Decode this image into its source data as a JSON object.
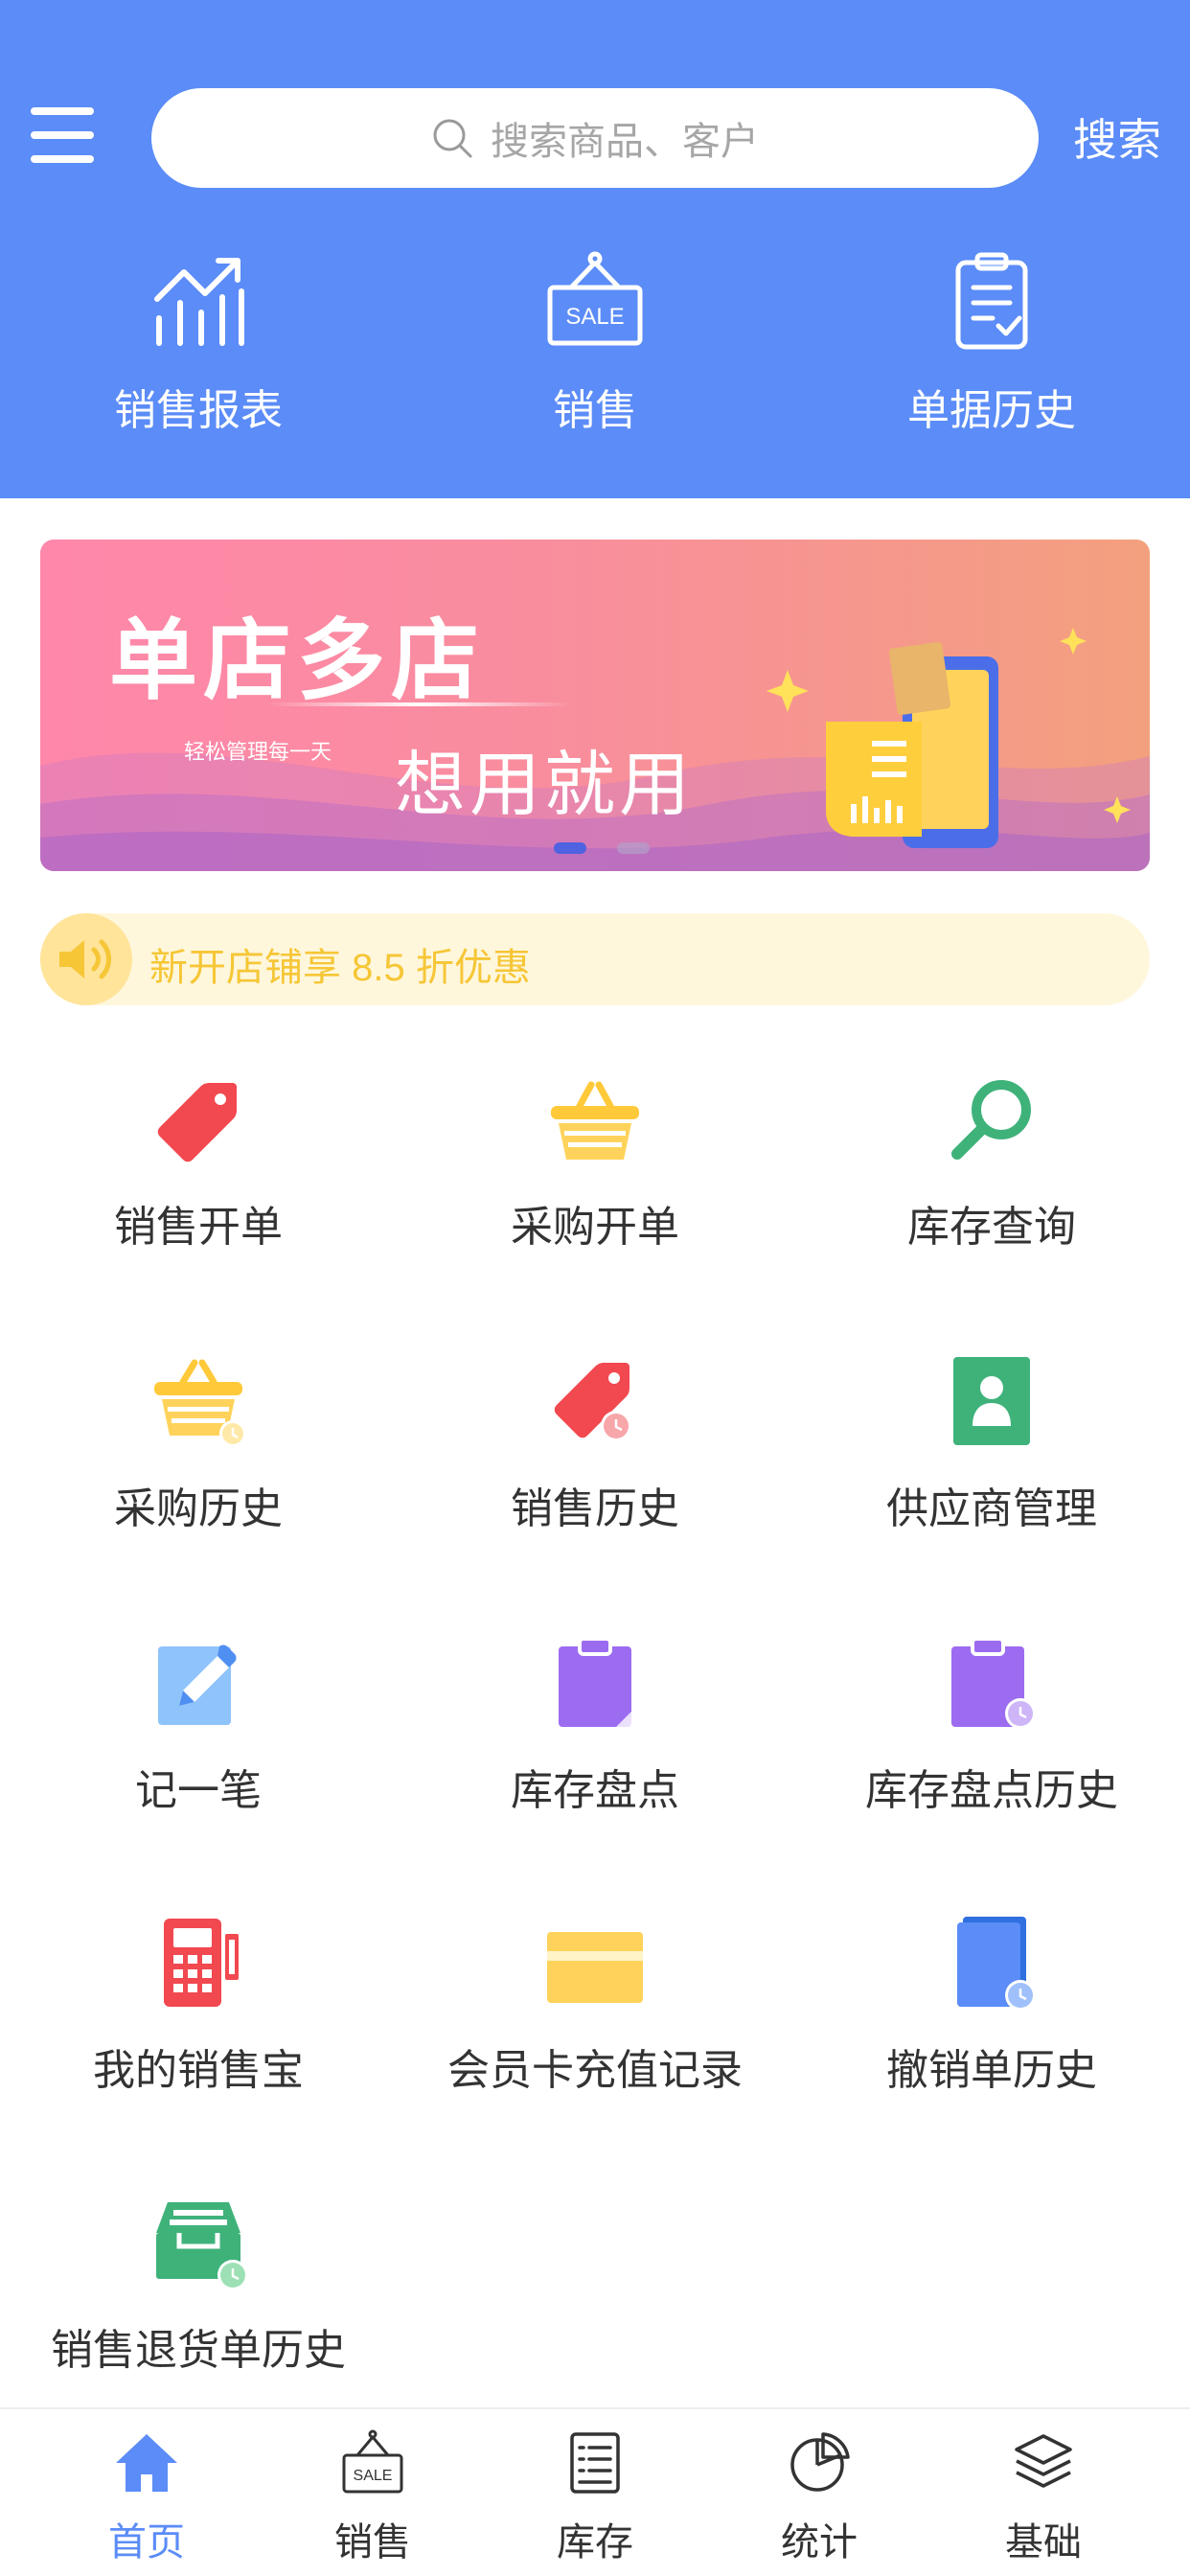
{
  "header": {
    "search_placeholder": "搜索商品、客户",
    "search_button": "搜索",
    "quick_actions": [
      {
        "label": "销售报表",
        "icon": "chart-trend-icon"
      },
      {
        "label": "销售",
        "icon": "sale-sign-icon"
      },
      {
        "label": "单据历史",
        "icon": "clipboard-check-icon"
      }
    ]
  },
  "banner": {
    "title": "单店多店",
    "subtitle_small": "轻松管理每一天",
    "subtitle_big": "想用就用",
    "dots": 2,
    "active_dot": 0
  },
  "notice": {
    "text": "新开店铺享 8.5 折优惠"
  },
  "grid": [
    {
      "label": "销售开单",
      "icon": "price-tag-icon"
    },
    {
      "label": "采购开单",
      "icon": "basket-icon"
    },
    {
      "label": "库存查询",
      "icon": "magnifier-icon"
    },
    {
      "label": "采购历史",
      "icon": "basket-history-icon"
    },
    {
      "label": "销售历史",
      "icon": "tag-history-icon"
    },
    {
      "label": "供应商管理",
      "icon": "supplier-contact-icon"
    },
    {
      "label": "记一笔",
      "icon": "note-pencil-icon"
    },
    {
      "label": "库存盘点",
      "icon": "clipboard-icon"
    },
    {
      "label": "库存盘点历史",
      "icon": "clipboard-history-icon"
    },
    {
      "label": "我的销售宝",
      "icon": "pos-terminal-icon"
    },
    {
      "label": "会员卡充值记录",
      "icon": "card-icon"
    },
    {
      "label": "撤销单历史",
      "icon": "document-history-icon"
    },
    {
      "label": "销售退货单历史",
      "icon": "return-box-history-icon"
    }
  ],
  "tabbar": [
    {
      "label": "首页",
      "icon": "home-icon",
      "active": true
    },
    {
      "label": "销售",
      "icon": "sale-sign-icon",
      "active": false
    },
    {
      "label": "库存",
      "icon": "list-icon",
      "active": false
    },
    {
      "label": "统计",
      "icon": "pie-chart-icon",
      "active": false
    },
    {
      "label": "基础",
      "icon": "layers-icon",
      "active": false
    }
  ],
  "colors": {
    "primary": "#5b8cf7",
    "notice_bg": "#fff7dc",
    "notice_text": "#f6c636",
    "red": "#f2484f",
    "yellow": "#ffd35b",
    "green": "#3fb27a",
    "purple": "#9b6cf0",
    "blue": "#5b8cf7"
  }
}
